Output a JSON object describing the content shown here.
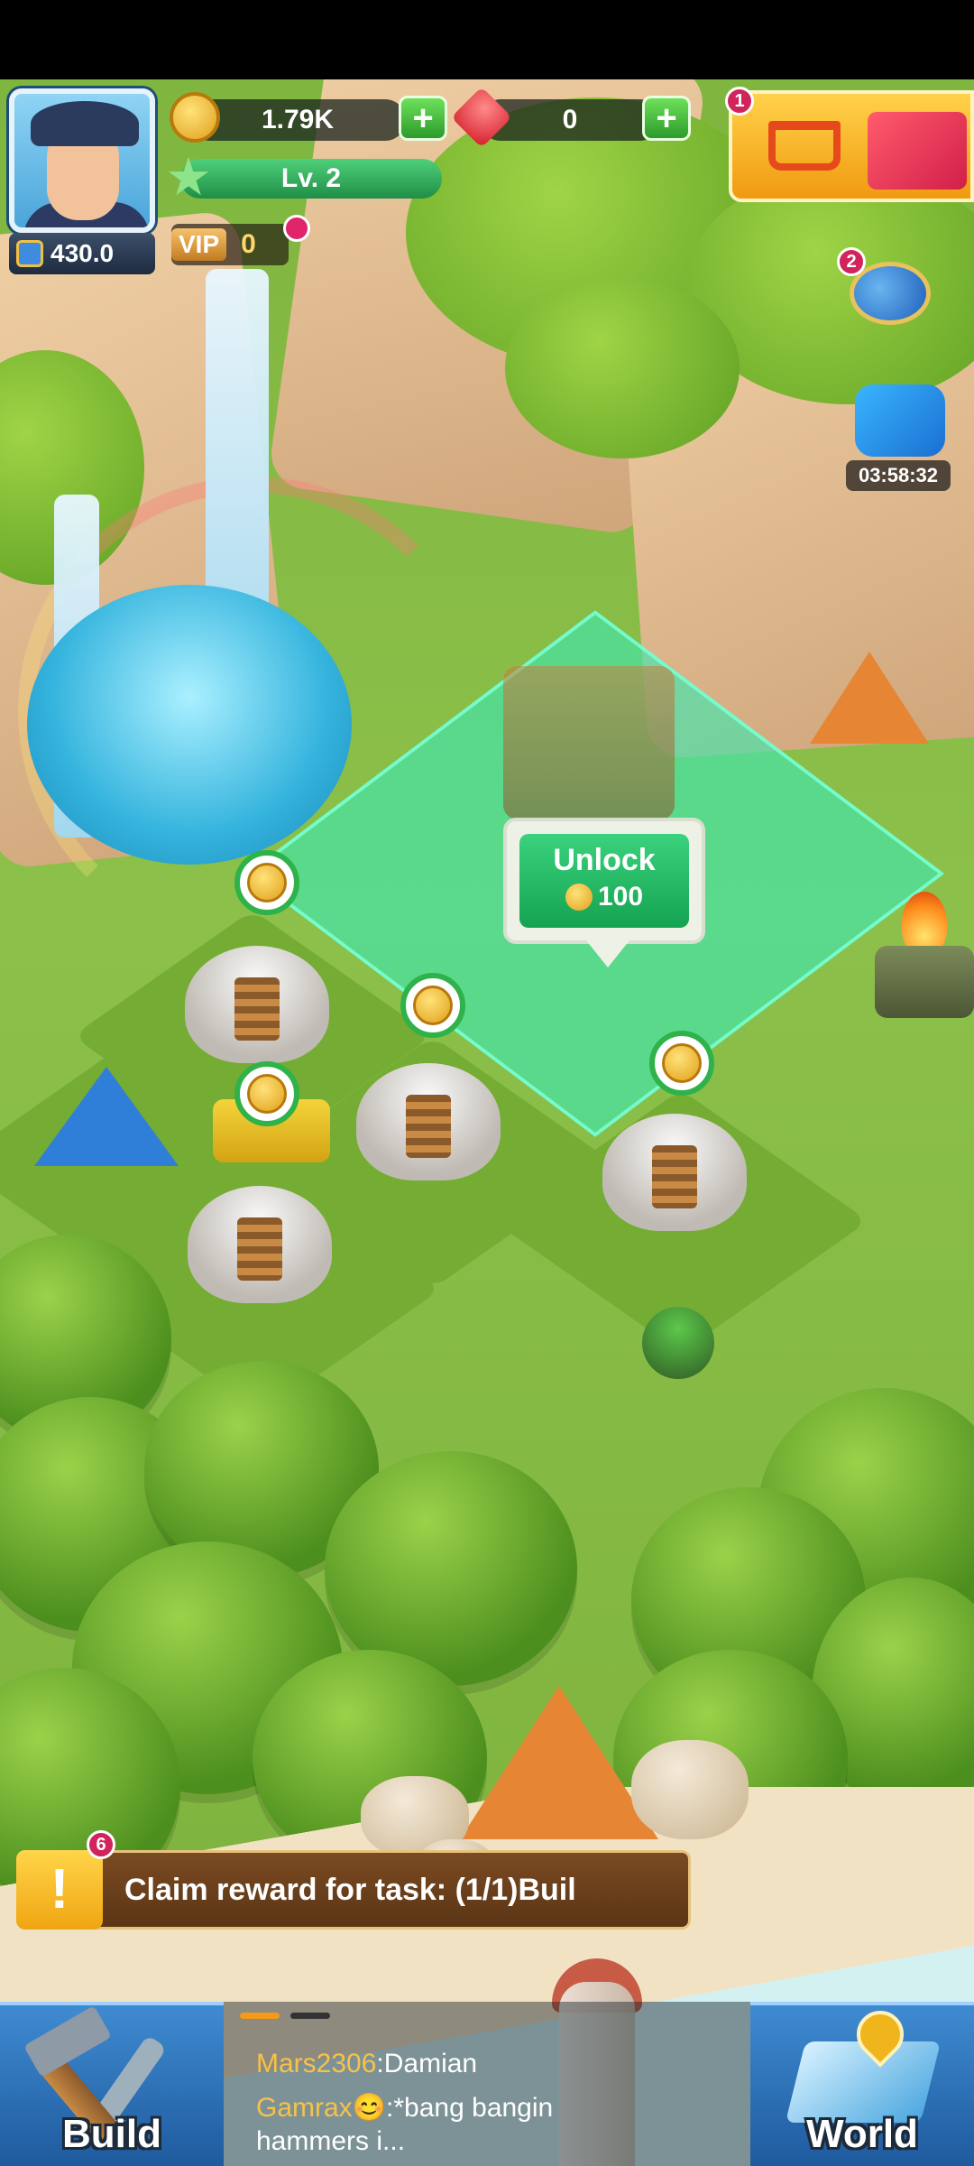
{
  "colors": {
    "grass": "#86bb45",
    "locked_zone": "#40e6af",
    "unlock_button": "#14a351",
    "task_bar": "#5a3515",
    "task_icon": "#f0a512",
    "chat_name": "#f6c24a",
    "bottom_buttons": "#1f5a9e"
  },
  "hud": {
    "power": "430.0",
    "power_icon": "shield-rank-icon",
    "coins": "1.79K",
    "gems": "0",
    "level": "Lv. 2",
    "vip_tag": "VIP",
    "vip_value": "0",
    "plus": "+",
    "star": "★"
  },
  "badges": {
    "shop": "1",
    "announcements": "2",
    "tasks": "6"
  },
  "event": {
    "timer": "03:58:32"
  },
  "unlock": {
    "label": "Unlock",
    "cost": "100"
  },
  "task": {
    "icon": "!",
    "text": "Claim reward for task: (1/1)Buil"
  },
  "bottom": {
    "build_label": "Build",
    "world_label": "World"
  },
  "chat": {
    "messages": [
      {
        "name": "Mars2306",
        "text": ":Damian"
      },
      {
        "name": "Gamrax😊",
        "text": ":*bang bangin",
        "continuation": "hammers i..."
      }
    ]
  }
}
